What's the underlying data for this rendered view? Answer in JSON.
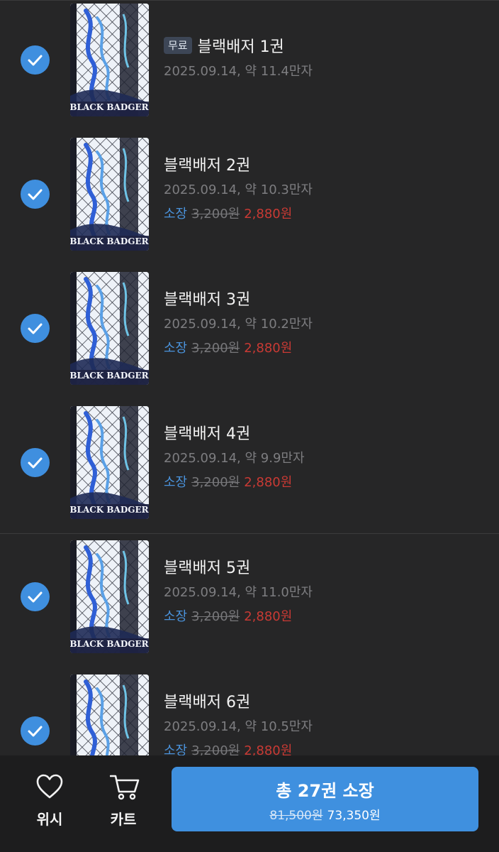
{
  "volumes": [
    {
      "badge": "무료",
      "title": "블랙배저 1권",
      "meta": "2025.09.14, 약 11.4만자",
      "own_label": "",
      "original_price": "",
      "sale_price": "",
      "checked": true
    },
    {
      "badge": "",
      "title": "블랙배저 2권",
      "meta": "2025.09.14, 약 10.3만자",
      "own_label": "소장",
      "original_price": "3,200원",
      "sale_price": "2,880원",
      "checked": true
    },
    {
      "badge": "",
      "title": "블랙배저 3권",
      "meta": "2025.09.14, 약 10.2만자",
      "own_label": "소장",
      "original_price": "3,200원",
      "sale_price": "2,880원",
      "checked": true
    },
    {
      "badge": "",
      "title": "블랙배저 4권",
      "meta": "2025.09.14, 약 9.9만자",
      "own_label": "소장",
      "original_price": "3,200원",
      "sale_price": "2,880원",
      "checked": true
    },
    {
      "badge": "",
      "title": "블랙배저 5권",
      "meta": "2025.09.14, 약 11.0만자",
      "own_label": "소장",
      "original_price": "3,200원",
      "sale_price": "2,880원",
      "checked": true
    },
    {
      "badge": "",
      "title": "블랙배저 6권",
      "meta": "2025.09.14, 약 10.5만자",
      "own_label": "소장",
      "original_price": "3,200원",
      "sale_price": "2,880원",
      "checked": true
    }
  ],
  "cover_text": "BLACK BADGER",
  "bottom_bar": {
    "wish_label": "위시",
    "wish_icon": "heart-icon",
    "cart_label": "카트",
    "cart_icon": "cart-icon",
    "buy_label": "총 27권 소장",
    "buy_original_total": "81,500원",
    "buy_sale_total": "73,350원"
  },
  "colors": {
    "background": "#262627",
    "accent": "#3f90df",
    "sale_price": "#c93a34",
    "own_label": "#4a93dc"
  }
}
